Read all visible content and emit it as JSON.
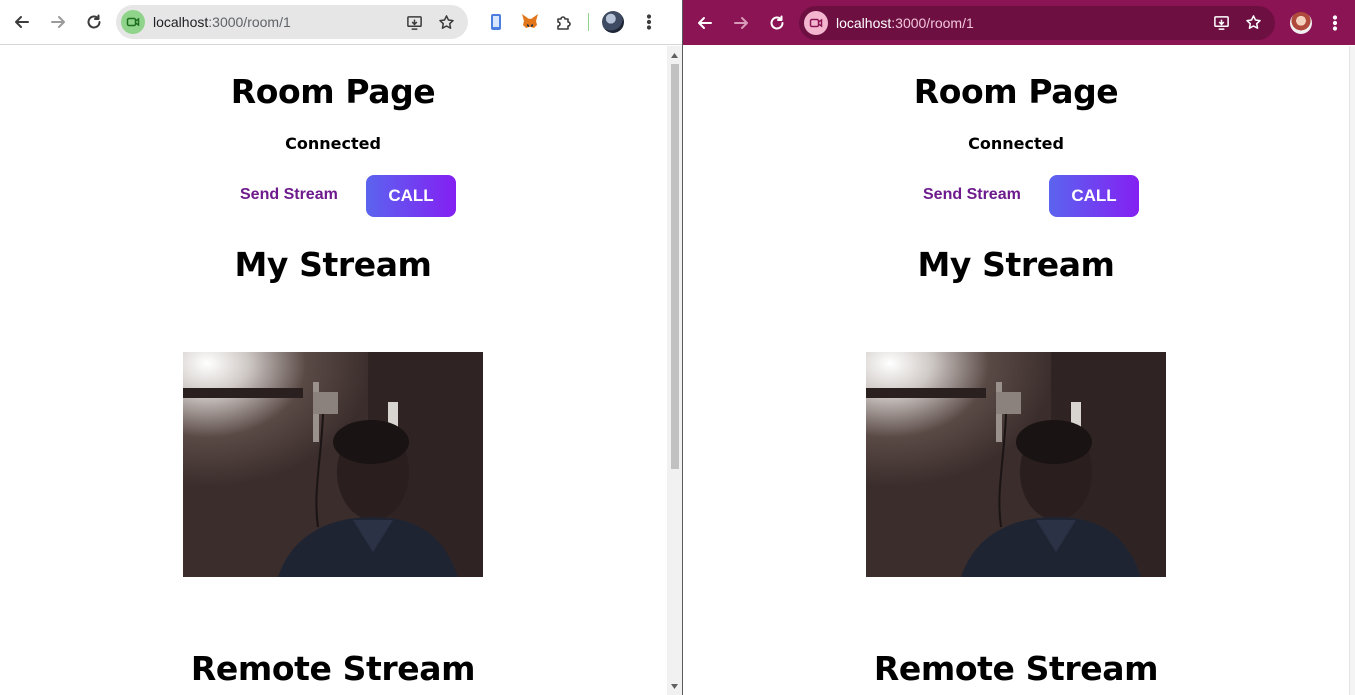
{
  "left_window": {
    "url_host": "localhost",
    "url_path": ":3000/room/1",
    "toolbar_colors": {
      "frame": "#ffffff",
      "site_chip": "#8fd48a"
    },
    "page": {
      "title": "Room Page",
      "status": "Connected",
      "send_stream_label": "Send Stream",
      "call_label": "CALL",
      "my_stream_heading": "My Stream",
      "remote_stream_heading": "Remote Stream"
    }
  },
  "right_window": {
    "url_host": "localhost",
    "url_path": ":3000/room/1",
    "toolbar_colors": {
      "frame": "#8a1454",
      "site_chip": "#f4b6cf"
    },
    "page": {
      "title": "Room Page",
      "status": "Connected",
      "send_stream_label": "Send Stream",
      "call_label": "CALL",
      "my_stream_heading": "My Stream",
      "remote_stream_heading": "Remote Stream"
    }
  },
  "colors": {
    "send_stream_text": "#6d1a8d",
    "call_gradient_start": "#5b64ef",
    "call_gradient_end": "#8420f2"
  },
  "icons": {
    "toolbar": [
      "back-arrow-icon",
      "forward-arrow-icon",
      "reload-icon",
      "install-app-icon",
      "bookmark-star-icon",
      "menu-kebab-icon"
    ],
    "extensions": [
      "phone-extension-icon",
      "metamask-fox-icon",
      "puzzle-extensions-icon"
    ],
    "site": "video-camera-icon"
  }
}
